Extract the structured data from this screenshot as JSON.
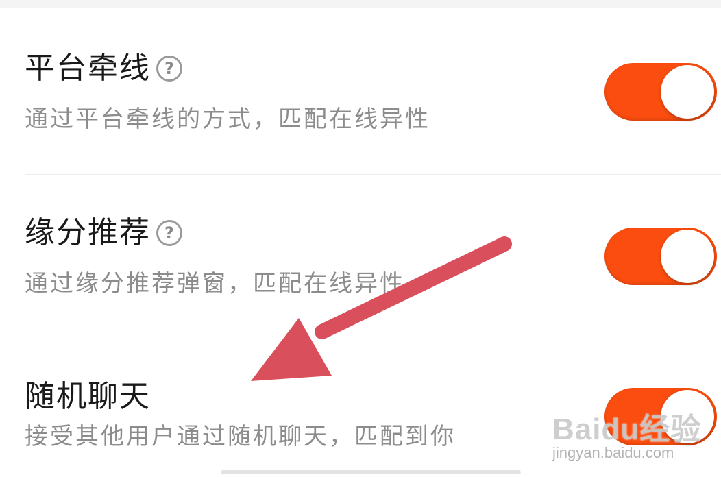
{
  "settings": {
    "items": [
      {
        "title": "平台牵线",
        "has_help": true,
        "description": "通过平台牵线的方式，匹配在线异性",
        "enabled": true
      },
      {
        "title": "缘分推荐",
        "has_help": true,
        "description": "通过缘分推荐弹窗，匹配在线异性",
        "enabled": true
      },
      {
        "title": "随机聊天",
        "has_help": false,
        "description": "接受其他用户通过随机聊天，匹配到你",
        "enabled": true
      }
    ],
    "help_glyph": "?"
  },
  "annotation": {
    "arrow_color": "#d94f5c"
  },
  "colors": {
    "toggle_on": "#fa4d0f",
    "title_text": "#1a1a1a",
    "desc_text": "#8c8c8c"
  },
  "watermark": {
    "brand": "Baidu经验",
    "url": "jingyan.baidu.com"
  }
}
